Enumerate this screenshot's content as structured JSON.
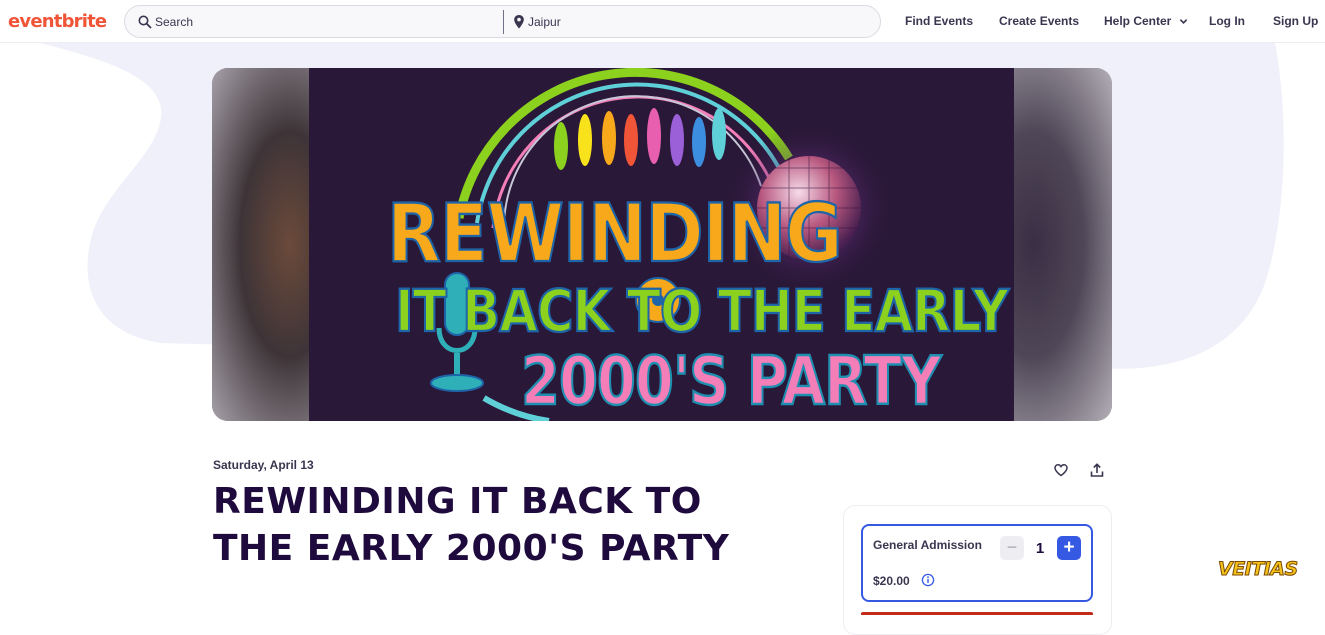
{
  "header": {
    "logo": "eventbrite",
    "search_placeholder": "Search",
    "location": "Jaipur",
    "nav": {
      "find_events": "Find Events",
      "create_events": "Create Events",
      "help_center": "Help Center",
      "log_in": "Log In",
      "sign_up": "Sign Up"
    }
  },
  "hero": {
    "poster_line1": "REWINDING",
    "poster_line2": "IT BACK TO THE EARLY",
    "poster_line3": "2000'S PARTY"
  },
  "event": {
    "date": "Saturday, April 13",
    "title": "REWINDING IT BACK TO THE EARLY 2000'S PARTY"
  },
  "ticket": {
    "name": "General Admission",
    "quantity": "1",
    "minus_label": "−",
    "plus_label": "+",
    "price": "$20.00"
  },
  "colors": {
    "brand": "#f05537",
    "accent": "#3659e3",
    "title": "#1e0a3c",
    "blob": "#eff0fa"
  },
  "watermark": "VEITIAS"
}
